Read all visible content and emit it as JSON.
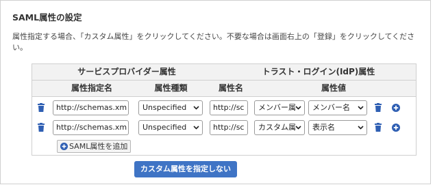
{
  "section": {
    "title": "SAML属性の設定",
    "description": "属性指定する場合、「カスタム属性」をクリックしてください。不要な場合は画面右上の「登録」をクリックしてください。"
  },
  "table": {
    "group_headers": {
      "sp": "サービスプロバイダー属性",
      "idp": "トラスト・ログイン(IdP)属性"
    },
    "column_headers": {
      "attr_spec": "属性指定名",
      "attr_type": "属性種類",
      "attr_name": "属性名",
      "attr_value": "属性値"
    },
    "rows": [
      {
        "attr_spec": "http://schemas.xm",
        "attr_type": "Unspecified",
        "attr_name": "http://sc",
        "value_source": "メンバー属",
        "value_field": "メンバー名"
      },
      {
        "attr_spec": "http://schemas.xm",
        "attr_type": "Unspecified",
        "attr_name": "http://sc",
        "value_source": "カスタム属",
        "value_field": "表示名"
      }
    ],
    "add_button_label": "SAML属性を追加"
  },
  "primary_button_label": "カスタム属性を指定しない",
  "colors": {
    "accent": "#3f74c5",
    "icon_blue": "#2f5fb3",
    "header_bg": "#f2f2f2",
    "border": "#cfcfcf"
  },
  "icons": {
    "delete": "trash-icon",
    "add": "plus-circle-icon",
    "dropdown": "chevron-down-icon"
  }
}
